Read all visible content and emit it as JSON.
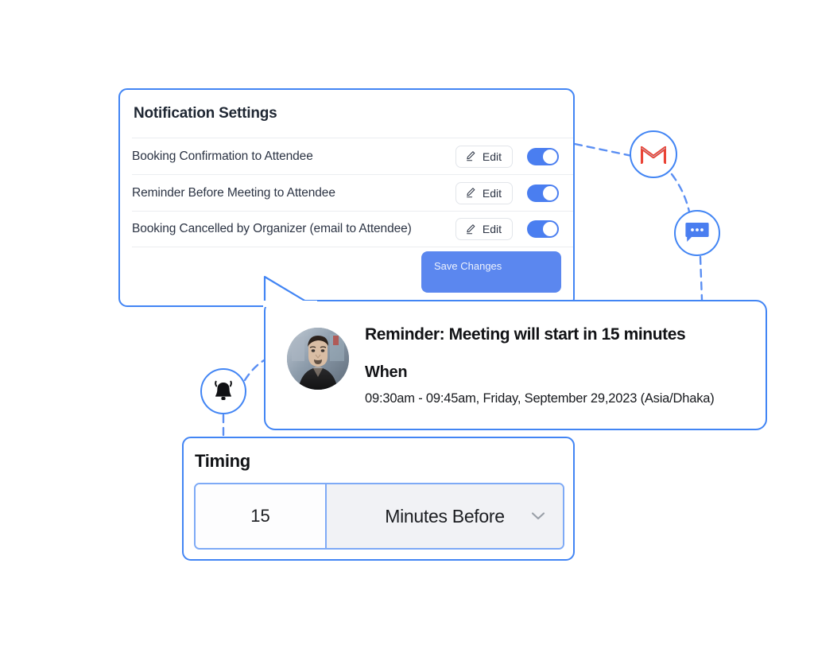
{
  "theme": {
    "accent_blue": "#4285f4",
    "toggle_blue": "#4a7ef0",
    "save_button_blue": "#5b87ef",
    "gmail_red": "#ea4335",
    "divider_gray": "#ebedf0",
    "dropdown_gray": "#f1f2f5"
  },
  "settings_panel": {
    "title": "Notification Settings",
    "rows": [
      {
        "label": "Booking Confirmation to Attendee",
        "edit_label": "Edit",
        "edit_icon": "pencil-icon",
        "toggle_state": "on"
      },
      {
        "label": "Reminder Before Meeting to Attendee",
        "edit_label": "Edit",
        "edit_icon": "pencil-icon",
        "toggle_state": "on"
      },
      {
        "label": "Booking Cancelled by Organizer (email to Attendee)",
        "edit_label": "Edit",
        "edit_icon": "pencil-icon",
        "toggle_state": "on"
      }
    ],
    "save_button_label": "Save Changes"
  },
  "reminder_card": {
    "avatar_icon": "user-avatar-photo",
    "heading": "Reminder: Meeting will start in 15 minutes",
    "when_label": "When",
    "when_value": "09:30am  - 09:45am, Friday, September 29,2023 (Asia/Dhaka)"
  },
  "timing_panel": {
    "title": "Timing",
    "amount_value": "15",
    "unit_value": "Minutes Before",
    "chevron_icon": "chevron-down-icon"
  },
  "floating_icons": [
    {
      "name": "gmail-icon",
      "glyph": "M"
    },
    {
      "name": "chat-bubble-icon",
      "glyph": "•••"
    },
    {
      "name": "bell-icon",
      "glyph": "🔔"
    }
  ]
}
